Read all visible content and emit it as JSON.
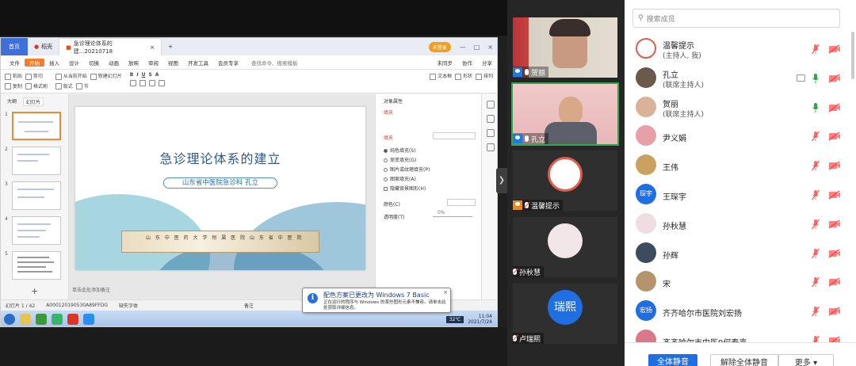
{
  "share": {
    "tabs": {
      "home": "首页",
      "docer": "稻壳",
      "doc": "急诊理论体系的建...20210718",
      "new": "+"
    },
    "login": "未登录",
    "menu": [
      "文件",
      "开始",
      "插入",
      "设计",
      "切换",
      "动画",
      "放映",
      "审阅",
      "视图",
      "开发工具",
      "会员专享"
    ],
    "menu_search": "查找命令、搜索模板",
    "menu_right": [
      "未同步",
      "协作",
      "分享"
    ],
    "ribbon": {
      "g1": [
        "粘贴",
        "剪切",
        "复制",
        "格式刷"
      ],
      "g2": [
        "从当前开始",
        "新建幻灯片",
        "版式",
        "节"
      ],
      "g3": [
        "文本框",
        "形状",
        "排列"
      ]
    },
    "thumb_tabs": [
      "大纲",
      "幻灯片"
    ],
    "thumb_nums": [
      "1",
      "2",
      "3",
      "4",
      "5"
    ],
    "thumb_add": "+",
    "slide": {
      "title": "急诊理论体系的建立",
      "subtitle": "山东省中医院急诊科  孔立",
      "banner": "山 东 中 医 药 大 学 附 属 医 院  山 东 省 中 医 院"
    },
    "canvas_note": "单击此处添加备注",
    "props": {
      "header": "对象属性",
      "tab": "填充",
      "section": "填充",
      "options": [
        "纯色填充(S)",
        "渐变填充(G)",
        "图片或纹理填充(P)",
        "图案填充(A)",
        "隐藏背景图形(H)"
      ],
      "color_label": "颜色(C)",
      "transparency_label": "透明度(T)",
      "transparency_value": "0%"
    },
    "status": [
      "幻灯片 1 / 42",
      "A000120190530A89FFDG",
      "缺失字体",
      "备注"
    ],
    "tray": {
      "temp": "32℃",
      "time": "11:04",
      "date": "2021/7/24"
    },
    "balloon": {
      "title": "配色方案已更改为 Windows 7 Basic",
      "body": "正在运行的程序与 Windows 的某些图形元素不兼容。请单击此处获取详细信息。",
      "close": "×"
    },
    "collapse": "❯"
  },
  "videos": [
    {
      "name": "贺丽"
    },
    {
      "name": "孔立"
    },
    {
      "name": "温馨提示"
    },
    {
      "name": "孙秋慧"
    },
    {
      "name": "卢瑞熙",
      "avatar": "瑞熙"
    }
  ],
  "members": {
    "search_placeholder": "搜索成员",
    "list": [
      {
        "name": "温馨提示",
        "role": "(主持人, 我)"
      },
      {
        "name": "孔立",
        "role": "(联席主持人)"
      },
      {
        "name": "贺丽",
        "role": "(联席主持人)"
      },
      {
        "name": "尹义娟"
      },
      {
        "name": "王伟"
      },
      {
        "name": "王琛宇",
        "avatar": "琛宇"
      },
      {
        "name": "孙秋慧"
      },
      {
        "name": "孙辉"
      },
      {
        "name": "宋"
      },
      {
        "name": "齐齐哈尔市医院刘宏扬",
        "avatar": "宏扬"
      },
      {
        "name": "齐齐哈尔市中医9何春来"
      }
    ],
    "buttons": {
      "mute_all": "全体静音",
      "unmute_all": "解除全体静音",
      "more": "更多 ▾"
    }
  },
  "colors": {
    "accent": "#1f6fe3",
    "wps_orange": "#f47c2a",
    "muted_red": "#ff4d4d",
    "active_green": "#2ea84a"
  }
}
